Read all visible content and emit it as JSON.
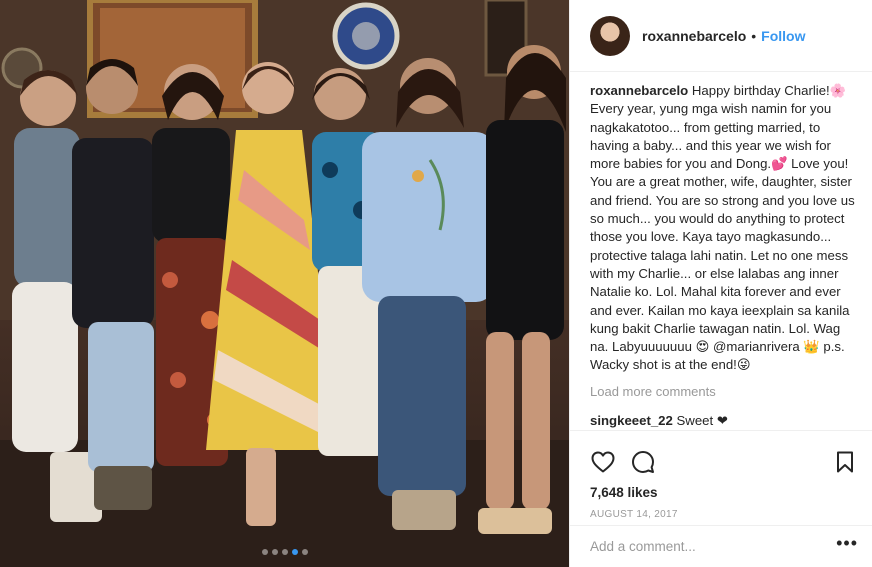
{
  "post": {
    "username": "roxannebarcelo",
    "separator": "•",
    "follow_label": "Follow",
    "caption_text": "Happy birthday Charlie!🌸 Every year, yung mga wish namin for you nagkakatotoo... from getting married, to having a baby... and this year we wish for more babies for you and Dong.💕 Love you! You are a great mother, wife, daughter, sister and friend. You are so strong and you love us so much... you would do anything to protect those you love. Kaya tayo magkasundo... protective talaga lahi natin. Let no one mess with my Charlie... or else lalabas ang inner Natalie ko. Lol. Mahal kita forever and ever and ever. Kailan mo kaya ieexplain sa kanila kung bakit Charlie tawagan natin. Lol. Wag na. Labyuuuuuuu 😍 @marianrivera 👑 p.s. Wacky shot is at the end!😜",
    "load_more_label": "Load more comments",
    "comments": [
      {
        "user": "singkeeet_22",
        "text": "Sweet ❤"
      }
    ],
    "likes": "7,648 likes",
    "date": "AUGUST 14, 2017",
    "add_comment_placeholder": "Add a comment...",
    "more_options": "•••",
    "carousel": {
      "count": 5,
      "active_index": 3
    }
  },
  "icons": {
    "like": "heart-icon",
    "comment": "speech-bubble-icon",
    "save": "bookmark-icon",
    "options": "more-options-icon"
  },
  "colors": {
    "accent": "#3897f0",
    "text": "#262626",
    "muted": "#999999",
    "divider": "#efefef"
  }
}
